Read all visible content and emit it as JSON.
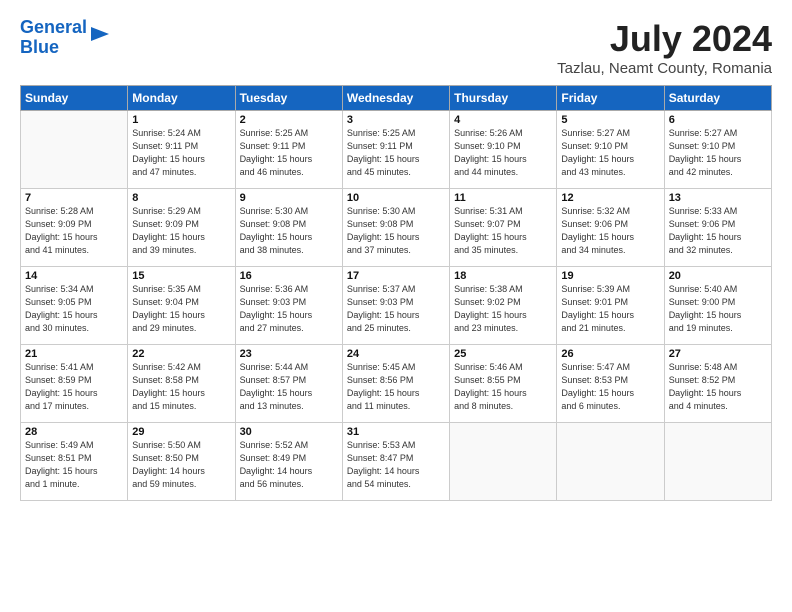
{
  "logo": {
    "line1": "General",
    "line2": "Blue"
  },
  "title": "July 2024",
  "location": "Tazlau, Neamt County, Romania",
  "weekdays": [
    "Sunday",
    "Monday",
    "Tuesday",
    "Wednesday",
    "Thursday",
    "Friday",
    "Saturday"
  ],
  "weeks": [
    [
      {
        "day": "",
        "info": ""
      },
      {
        "day": "1",
        "info": "Sunrise: 5:24 AM\nSunset: 9:11 PM\nDaylight: 15 hours\nand 47 minutes."
      },
      {
        "day": "2",
        "info": "Sunrise: 5:25 AM\nSunset: 9:11 PM\nDaylight: 15 hours\nand 46 minutes."
      },
      {
        "day": "3",
        "info": "Sunrise: 5:25 AM\nSunset: 9:11 PM\nDaylight: 15 hours\nand 45 minutes."
      },
      {
        "day": "4",
        "info": "Sunrise: 5:26 AM\nSunset: 9:10 PM\nDaylight: 15 hours\nand 44 minutes."
      },
      {
        "day": "5",
        "info": "Sunrise: 5:27 AM\nSunset: 9:10 PM\nDaylight: 15 hours\nand 43 minutes."
      },
      {
        "day": "6",
        "info": "Sunrise: 5:27 AM\nSunset: 9:10 PM\nDaylight: 15 hours\nand 42 minutes."
      }
    ],
    [
      {
        "day": "7",
        "info": "Sunrise: 5:28 AM\nSunset: 9:09 PM\nDaylight: 15 hours\nand 41 minutes."
      },
      {
        "day": "8",
        "info": "Sunrise: 5:29 AM\nSunset: 9:09 PM\nDaylight: 15 hours\nand 39 minutes."
      },
      {
        "day": "9",
        "info": "Sunrise: 5:30 AM\nSunset: 9:08 PM\nDaylight: 15 hours\nand 38 minutes."
      },
      {
        "day": "10",
        "info": "Sunrise: 5:30 AM\nSunset: 9:08 PM\nDaylight: 15 hours\nand 37 minutes."
      },
      {
        "day": "11",
        "info": "Sunrise: 5:31 AM\nSunset: 9:07 PM\nDaylight: 15 hours\nand 35 minutes."
      },
      {
        "day": "12",
        "info": "Sunrise: 5:32 AM\nSunset: 9:06 PM\nDaylight: 15 hours\nand 34 minutes."
      },
      {
        "day": "13",
        "info": "Sunrise: 5:33 AM\nSunset: 9:06 PM\nDaylight: 15 hours\nand 32 minutes."
      }
    ],
    [
      {
        "day": "14",
        "info": "Sunrise: 5:34 AM\nSunset: 9:05 PM\nDaylight: 15 hours\nand 30 minutes."
      },
      {
        "day": "15",
        "info": "Sunrise: 5:35 AM\nSunset: 9:04 PM\nDaylight: 15 hours\nand 29 minutes."
      },
      {
        "day": "16",
        "info": "Sunrise: 5:36 AM\nSunset: 9:03 PM\nDaylight: 15 hours\nand 27 minutes."
      },
      {
        "day": "17",
        "info": "Sunrise: 5:37 AM\nSunset: 9:03 PM\nDaylight: 15 hours\nand 25 minutes."
      },
      {
        "day": "18",
        "info": "Sunrise: 5:38 AM\nSunset: 9:02 PM\nDaylight: 15 hours\nand 23 minutes."
      },
      {
        "day": "19",
        "info": "Sunrise: 5:39 AM\nSunset: 9:01 PM\nDaylight: 15 hours\nand 21 minutes."
      },
      {
        "day": "20",
        "info": "Sunrise: 5:40 AM\nSunset: 9:00 PM\nDaylight: 15 hours\nand 19 minutes."
      }
    ],
    [
      {
        "day": "21",
        "info": "Sunrise: 5:41 AM\nSunset: 8:59 PM\nDaylight: 15 hours\nand 17 minutes."
      },
      {
        "day": "22",
        "info": "Sunrise: 5:42 AM\nSunset: 8:58 PM\nDaylight: 15 hours\nand 15 minutes."
      },
      {
        "day": "23",
        "info": "Sunrise: 5:44 AM\nSunset: 8:57 PM\nDaylight: 15 hours\nand 13 minutes."
      },
      {
        "day": "24",
        "info": "Sunrise: 5:45 AM\nSunset: 8:56 PM\nDaylight: 15 hours\nand 11 minutes."
      },
      {
        "day": "25",
        "info": "Sunrise: 5:46 AM\nSunset: 8:55 PM\nDaylight: 15 hours\nand 8 minutes."
      },
      {
        "day": "26",
        "info": "Sunrise: 5:47 AM\nSunset: 8:53 PM\nDaylight: 15 hours\nand 6 minutes."
      },
      {
        "day": "27",
        "info": "Sunrise: 5:48 AM\nSunset: 8:52 PM\nDaylight: 15 hours\nand 4 minutes."
      }
    ],
    [
      {
        "day": "28",
        "info": "Sunrise: 5:49 AM\nSunset: 8:51 PM\nDaylight: 15 hours\nand 1 minute."
      },
      {
        "day": "29",
        "info": "Sunrise: 5:50 AM\nSunset: 8:50 PM\nDaylight: 14 hours\nand 59 minutes."
      },
      {
        "day": "30",
        "info": "Sunrise: 5:52 AM\nSunset: 8:49 PM\nDaylight: 14 hours\nand 56 minutes."
      },
      {
        "day": "31",
        "info": "Sunrise: 5:53 AM\nSunset: 8:47 PM\nDaylight: 14 hours\nand 54 minutes."
      },
      {
        "day": "",
        "info": ""
      },
      {
        "day": "",
        "info": ""
      },
      {
        "day": "",
        "info": ""
      }
    ]
  ]
}
